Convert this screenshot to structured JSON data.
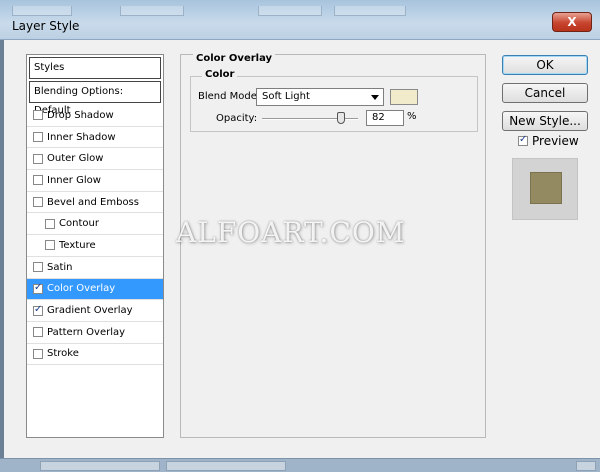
{
  "window": {
    "title": "Layer Style",
    "close_label": "X"
  },
  "styles": {
    "header": "Styles",
    "blending_options": "Blending Options: Default",
    "items": [
      {
        "label": "Drop Shadow",
        "checked": false,
        "indent": false,
        "selected": false
      },
      {
        "label": "Inner Shadow",
        "checked": false,
        "indent": false,
        "selected": false
      },
      {
        "label": "Outer Glow",
        "checked": false,
        "indent": false,
        "selected": false
      },
      {
        "label": "Inner Glow",
        "checked": false,
        "indent": false,
        "selected": false
      },
      {
        "label": "Bevel and Emboss",
        "checked": false,
        "indent": false,
        "selected": false
      },
      {
        "label": "Contour",
        "checked": false,
        "indent": true,
        "selected": false
      },
      {
        "label": "Texture",
        "checked": false,
        "indent": true,
        "selected": false
      },
      {
        "label": "Satin",
        "checked": false,
        "indent": false,
        "selected": false
      },
      {
        "label": "Color Overlay",
        "checked": true,
        "indent": false,
        "selected": true
      },
      {
        "label": "Gradient Overlay",
        "checked": true,
        "indent": false,
        "selected": false
      },
      {
        "label": "Pattern Overlay",
        "checked": false,
        "indent": false,
        "selected": false
      },
      {
        "label": "Stroke",
        "checked": false,
        "indent": false,
        "selected": false
      }
    ]
  },
  "overlay": {
    "group_title": "Color Overlay",
    "sub_title": "Color",
    "blend_mode_label": "Blend Mode:",
    "blend_mode_value": "Soft Light",
    "color_swatch": "#f1ebcc",
    "opacity_label": "Opacity:",
    "opacity_value": "82",
    "opacity_unit": "%",
    "opacity_fraction": 0.82
  },
  "buttons": {
    "ok": "OK",
    "cancel": "Cancel",
    "new_style": "New Style..."
  },
  "preview": {
    "label": "Preview",
    "checked": true,
    "swatch_color": "#938a62"
  },
  "watermark": "ALFOART.COM"
}
